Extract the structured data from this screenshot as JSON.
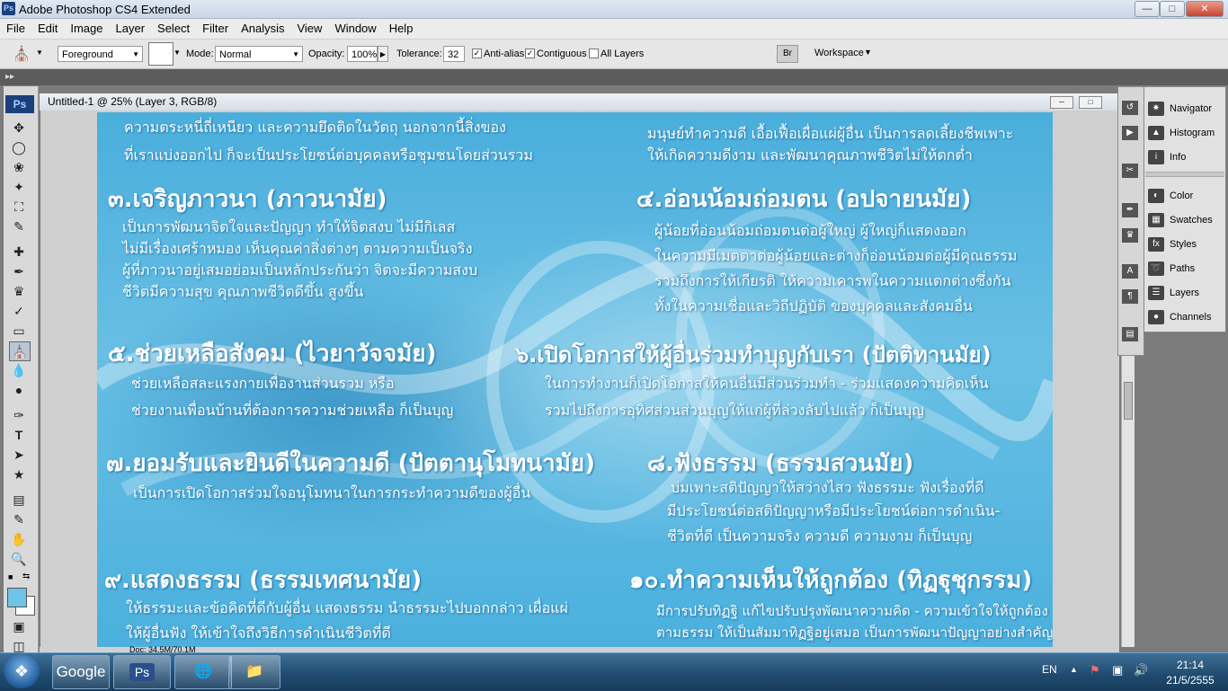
{
  "window": {
    "icon": "Ps",
    "title": "Adobe Photoshop CS4 Extended",
    "controls": {
      "minimize": "—",
      "maximize": "□",
      "close": "✕"
    }
  },
  "menu": [
    "File",
    "Edit",
    "Image",
    "Layer",
    "Select",
    "Filter",
    "Analysis",
    "View",
    "Window",
    "Help"
  ],
  "options": {
    "fill_source": "Foreground",
    "mode_label": "Mode:",
    "mode_value": "Normal",
    "opacity_label": "Opacity:",
    "opacity_value": "100%",
    "tolerance_label": "Tolerance:",
    "tolerance_value": "32",
    "antialias_label": "Anti-alias",
    "antialias_checked": true,
    "contiguous_label": "Contiguous",
    "contiguous_checked": true,
    "all_layers_label": "All Layers",
    "all_layers_checked": false,
    "workspace_label": "Workspace"
  },
  "toolbox": {
    "logo": "Ps"
  },
  "document": {
    "title": "Untitled-1 @ 25% (Layer 3, RGB/8)",
    "status": "Doc: 34.5M/70.1M"
  },
  "canvas": {
    "top_left_line1": "ความตระหนี่ถี่เหนียว และความยึดติดในวัตถุ นอกจากนี้สิ่งของ",
    "top_left_line2": "ที่เราแบ่งออกไป ก็จะเป็นประโยชน์ต่อบุคคลหรือชุมชนโดยส่วนรวม",
    "top_right_line1": "มนุษย์ทำความดี เอื้อเฟื้อเผื่อแผ่ผู้อื่น เป็นการลดเลี้ยงชีพเพาะ",
    "top_right_line2": "ให้เกิดความดีงาม และพัฒนาคุณภาพชีวิตไม่ให้ตกต่ำ",
    "h3": "๓.เจริญภาวนา (ภาวนามัย)",
    "b3": [
      "เป็นการพัฒนาจิตใจและปัญญา ทำให้จิตสงบ ไม่มีกิเลส",
      "ไม่มีเรื่องเศร้าหมอง เห็นคุณค่าสิ่งต่างๆ ตามความเป็นจริง",
      "ผู้ที่ภาวนาอยู่เสมอย่อมเป็นหลักประกันว่า จิตจะมีความสงบ",
      "ชีวิตมีความสุข คุณภาพชีวิตดีขึ้น สูงขึ้น"
    ],
    "h4": "๔.อ่อนน้อมถ่อมตน (อปจายนมัย)",
    "b4": [
      "ผู้น้อยที่อ่อนน้อมถ่อมตนต่อผู้ใหญ่ ผู้ใหญ่ก็แสดงออก",
      "ในความมีเมตตาต่อผู้น้อยและต่างก็อ่อนน้อมต่อผู้มีคุณธรรม",
      "รวมถึงการให้เกียรติ ให้ความเคารพในความแตกต่างซึ่งกัน",
      "ทั้งในความเชื่อและวิถีปฏิบัติ ของบุคคลและสังคมอื่น"
    ],
    "h5": "๕.ช่วยเหลือสังคม (ไวยาวัจจมัย)",
    "b5": [
      "ช่วยเหลือสละแรงกายเพื่องานส่วนรวม หรือ",
      "ช่วยงานเพื่อนบ้านที่ต้องการความช่วยเหลือ ก็เป็นบุญ"
    ],
    "h6": "๖.เปิดโอกาสให้ผู้อื่นร่วมทำบุญกับเรา (ปัตติทานมัย)",
    "b6": [
      "ในการทำงานก็เปิดโอกาสให้คนอื่นมีส่วนร่วมทำ - ร่วมแสดงความคิดเห็น",
      "รวมไปถึงการอุทิศส่วนส่วนบุญให้แก่ผู้ที่ล่วงลับไปแล้ว ก็เป็นบุญ"
    ],
    "h7": "๗.ยอมรับและยินดีในความดี (ปัตตานุโมทนามัย)",
    "b7": [
      "เป็นการเปิดโอกาสร่วมใจอนุโมทนาในการกระทำความดีของผู้อื่น"
    ],
    "h8": "๘.ฟังธรรม (ธรรมสวนมัย)",
    "b8": [
      "บ่มเพาะสติปัญญาให้สว่างไสว ฟังธรรมะ ฟังเรื่องที่ดี",
      "มีประโยชน์ต่อสติปัญญาหรือมีประโยชน์ต่อการดำเนิน-",
      "ชีวิตที่ดี เป็นความจริง ความดี ความงาม ก็เป็นบุญ"
    ],
    "h9": "๙.แสดงธรรม (ธรรมเทศนามัย)",
    "b9": [
      "ให้ธรรมะและข้อคิดที่ดีกับผู้อื่น แสดงธรรม นำธรรมะไปบอกกล่าว เผื่อแผ่",
      "ให้ผู้อื่นฟัง ให้เข้าใจถึงวิธีการดำเนินชีวิตที่ดี"
    ],
    "h10": "๑๐.ทำความเห็นให้ถูกต้อง (ทิฏฐุชุกรรม)",
    "b10": [
      "มีการปรับทิฏฐิ แก้ไขปรับปรุงพัฒนาความคิด - ความเข้าใจให้ถูกต้อง",
      "ตามธรรม ให้เป็นสัมมาทิฏฐิอยู่เสมอ เป็นการพัฒนาปัญญาอย่างสำคัญ"
    ]
  },
  "panels": [
    "Navigator",
    "Histogram",
    "Info",
    "Color",
    "Swatches",
    "Styles",
    "Paths",
    "Layers",
    "Channels"
  ],
  "taskbar": {
    "google_label": "Google",
    "ps_label": "Ps",
    "lang": "EN",
    "time": "21:14",
    "date": "21/5/2555"
  }
}
